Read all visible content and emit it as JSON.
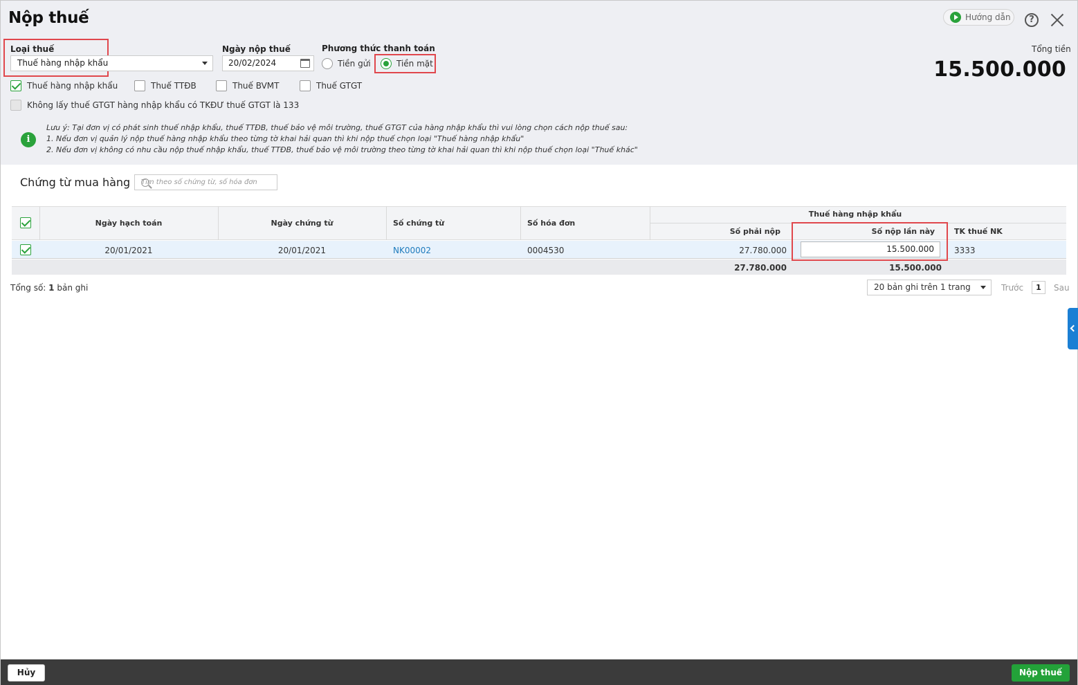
{
  "dialog": {
    "title": "Nộp thuế",
    "guide_label": "Hướng dẫn",
    "help_symbol": "?",
    "total_label": "Tổng tiền",
    "total_value": "15.500.000"
  },
  "form": {
    "tax_type_label": "Loại thuế",
    "tax_type_value": "Thuế hàng nhập khẩu",
    "pay_date_label": "Ngày nộp thuế",
    "pay_date_value": "20/02/2024",
    "payment_method_label": "Phương thức thanh toán",
    "payment_options": [
      {
        "label": "Tiền gửi",
        "selected": false
      },
      {
        "label": "Tiền mặt",
        "selected": true
      }
    ],
    "tax_checkboxes": [
      {
        "label": "Thuế hàng nhập khẩu",
        "checked": true
      },
      {
        "label": "Thuế TTĐB",
        "checked": false
      },
      {
        "label": "Thuế BVMT",
        "checked": false
      },
      {
        "label": "Thuế GTGT",
        "checked": false
      }
    ],
    "exclude_vat_label": "Không lấy thuế GTGT hàng nhập khẩu có TKĐƯ thuế GTGT là 133"
  },
  "note": {
    "line1": "Lưu ý: Tại đơn vị có phát sinh thuế nhập khẩu, thuế TTĐB, thuế bảo vệ môi trường, thuế GTGT của hàng nhập khẩu thì vui lòng chọn cách nộp thuế sau:",
    "line2": "1. Nếu đơn vị quản lý nộp thuế hàng nhập khẩu theo từng tờ khai hải quan thì khi nộp thuế chọn loại \"Thuế hàng nhập khẩu\"",
    "line3": "2. Nếu đơn vị không có nhu cầu nộp thuế nhập khẩu, thuế TTĐB, thuế bảo vệ môi trường theo từng tờ khai hải quan thì khi nộp thuế chọn loại \"Thuế khác\""
  },
  "section": {
    "title": "Chứng từ mua hàng",
    "search_placeholder": "Tìm theo số chứng từ, số hóa đơn"
  },
  "table": {
    "headers": {
      "posting_date": "Ngày hạch toán",
      "doc_date": "Ngày chứng từ",
      "doc_no": "Số chứng từ",
      "invoice_no": "Số hóa đơn",
      "group": "Thuế hàng nhập khẩu",
      "amount_due": "Số phải nộp",
      "amount_now": "Số nộp lần này",
      "account": "TK thuế NK"
    },
    "rows": [
      {
        "checked": true,
        "posting_date": "20/01/2021",
        "doc_date": "20/01/2021",
        "doc_no": "NK00002",
        "invoice_no": "0004530",
        "amount_due": "27.780.000",
        "amount_now": "15.500.000",
        "account": "3333"
      }
    ],
    "totals": {
      "amount_due": "27.780.000",
      "amount_now": "15.500.000"
    }
  },
  "pager": {
    "total_prefix": "Tổng số: ",
    "total_count": "1",
    "total_suffix": " bản ghi",
    "page_size": "20 bản ghi trên 1 trang",
    "prev": "Trước",
    "page": "1",
    "next": "Sau"
  },
  "footer": {
    "cancel_label": "Hủy",
    "submit_label": "Nộp thuế"
  },
  "colors": {
    "accent_green": "#23a239",
    "highlight_red": "#e0474c",
    "link_blue": "#1e7bbd",
    "side_tab_blue": "#1b7fd4"
  }
}
